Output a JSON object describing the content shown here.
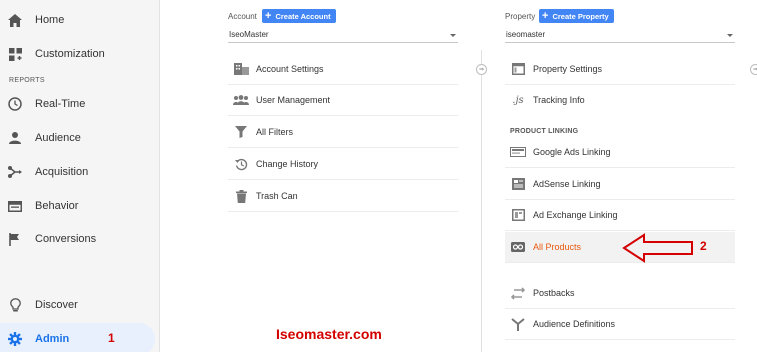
{
  "sidebar": {
    "items": [
      {
        "label": "Home",
        "icon": "home-icon"
      },
      {
        "label": "Customization",
        "icon": "dashboard-icon"
      },
      {
        "label": "Real-Time",
        "icon": "clock-icon"
      },
      {
        "label": "Audience",
        "icon": "person-icon"
      },
      {
        "label": "Acquisition",
        "icon": "acquisition-icon"
      },
      {
        "label": "Behavior",
        "icon": "behavior-icon"
      },
      {
        "label": "Conversions",
        "icon": "flag-icon"
      },
      {
        "label": "Discover",
        "icon": "lightbulb-icon"
      },
      {
        "label": "Admin",
        "icon": "gear-icon"
      }
    ],
    "section_label": "REPORTS",
    "active_item": "Admin",
    "marker": "1"
  },
  "account": {
    "label": "Account",
    "create_button": "Create Account",
    "selected": "IseoMaster",
    "items": [
      {
        "label": "Account Settings",
        "icon": "building-icon"
      },
      {
        "label": "User Management",
        "icon": "users-icon"
      },
      {
        "label": "All Filters",
        "icon": "filter-icon"
      },
      {
        "label": "Change History",
        "icon": "history-icon"
      },
      {
        "label": "Trash Can",
        "icon": "trash-icon"
      }
    ]
  },
  "property": {
    "label": "Property",
    "create_button": "Create Property",
    "selected": "iseomaster",
    "items": [
      {
        "label": "Property Settings",
        "icon": "settings-window-icon"
      },
      {
        "label": "Tracking Info",
        "icon": "js-icon"
      }
    ],
    "product_linking_label": "PRODUCT LINKING",
    "linking_items": [
      {
        "label": "Google Ads Linking",
        "icon": "ads-icon"
      },
      {
        "label": "AdSense Linking",
        "icon": "adsense-icon"
      },
      {
        "label": "Ad Exchange Linking",
        "icon": "ad-exchange-icon"
      },
      {
        "label": "All Products",
        "icon": "link-icon"
      },
      {
        "label": "Postbacks",
        "icon": "postbacks-icon"
      },
      {
        "label": "Audience Definitions",
        "icon": "audience-definitions-icon"
      }
    ],
    "highlighted_item": "All Products"
  },
  "annotations": {
    "watermark": "Iseomaster.com",
    "marker_2": "2",
    "highlight_color": "#d40000"
  },
  "colors": {
    "accent": "#4285f4",
    "active_bg": "#e8f0fe",
    "highlight_text": "#e8590c"
  }
}
